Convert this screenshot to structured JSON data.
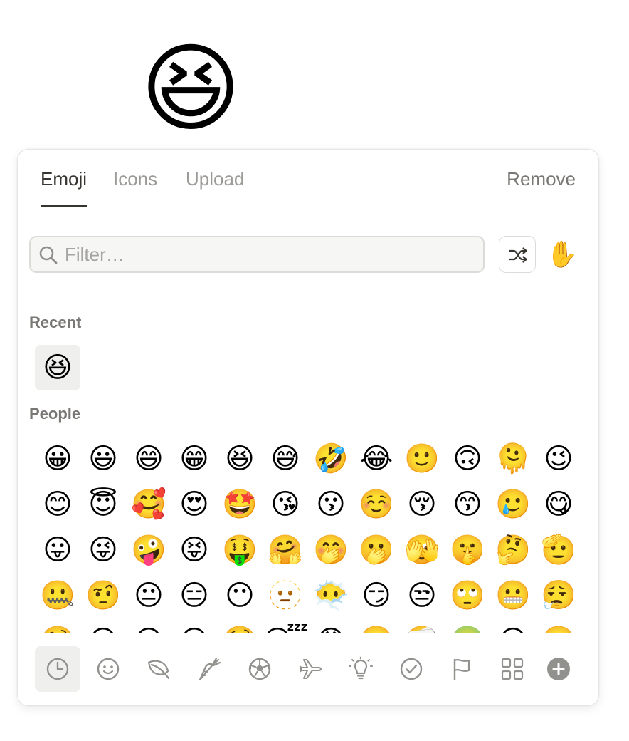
{
  "page": {
    "icon_emoji": "😆"
  },
  "tabs": {
    "emoji": "Emoji",
    "icons": "Icons",
    "upload": "Upload",
    "remove": "Remove",
    "active": "emoji"
  },
  "search": {
    "placeholder": "Filter…",
    "value": ""
  },
  "toolbar": {
    "shuffle_icon": "shuffle-icon",
    "skin_tone_emoji": "✋"
  },
  "sections": {
    "recent": {
      "label": "Recent",
      "emojis": [
        "😆"
      ]
    },
    "people": {
      "label": "People",
      "emojis": [
        "😀",
        "😃",
        "😄",
        "😁",
        "😆",
        "😅",
        "🤣",
        "😂",
        "🙂",
        "🙃",
        "🫠",
        "😉",
        "😊",
        "😇",
        "🥰",
        "😍",
        "🤩",
        "😘",
        "😗",
        "☺️",
        "😚",
        "😙",
        "🥲",
        "😋",
        "😛",
        "😜",
        "🤪",
        "😝",
        "🤑",
        "🤗",
        "🤭",
        "🫢",
        "🫣",
        "🤫",
        "🤔",
        "🫡",
        "🤐",
        "🤨",
        "😐",
        "😑",
        "😶",
        "🫥",
        "😶‍🌫️",
        "😏",
        "😒",
        "🙄",
        "😬",
        "😮‍💨",
        "🤥",
        "😌",
        "😔",
        "😪",
        "🤤",
        "😴",
        "😷",
        "🤒",
        "🤕",
        "🤢",
        "😵",
        "🥴"
      ]
    }
  },
  "categories": [
    {
      "name": "recent",
      "icon": "clock-icon"
    },
    {
      "name": "people",
      "icon": "smiley-icon"
    },
    {
      "name": "nature",
      "icon": "leaf-icon"
    },
    {
      "name": "food",
      "icon": "carrot-icon"
    },
    {
      "name": "activity",
      "icon": "soccer-ball-icon"
    },
    {
      "name": "travel",
      "icon": "airplane-icon"
    },
    {
      "name": "objects",
      "icon": "lightbulb-icon"
    },
    {
      "name": "symbols",
      "icon": "check-circle-icon"
    },
    {
      "name": "flags",
      "icon": "flag-icon"
    },
    {
      "name": "custom",
      "icon": "grid-icon"
    },
    {
      "name": "add",
      "icon": "plus-circle-icon"
    }
  ],
  "colors": {
    "text_primary": "#37352f",
    "text_secondary": "#787774",
    "text_muted": "#9b9a97",
    "icon_gray": "#91918e",
    "selected_bg": "#efefed",
    "border": "#e9e9e7"
  }
}
